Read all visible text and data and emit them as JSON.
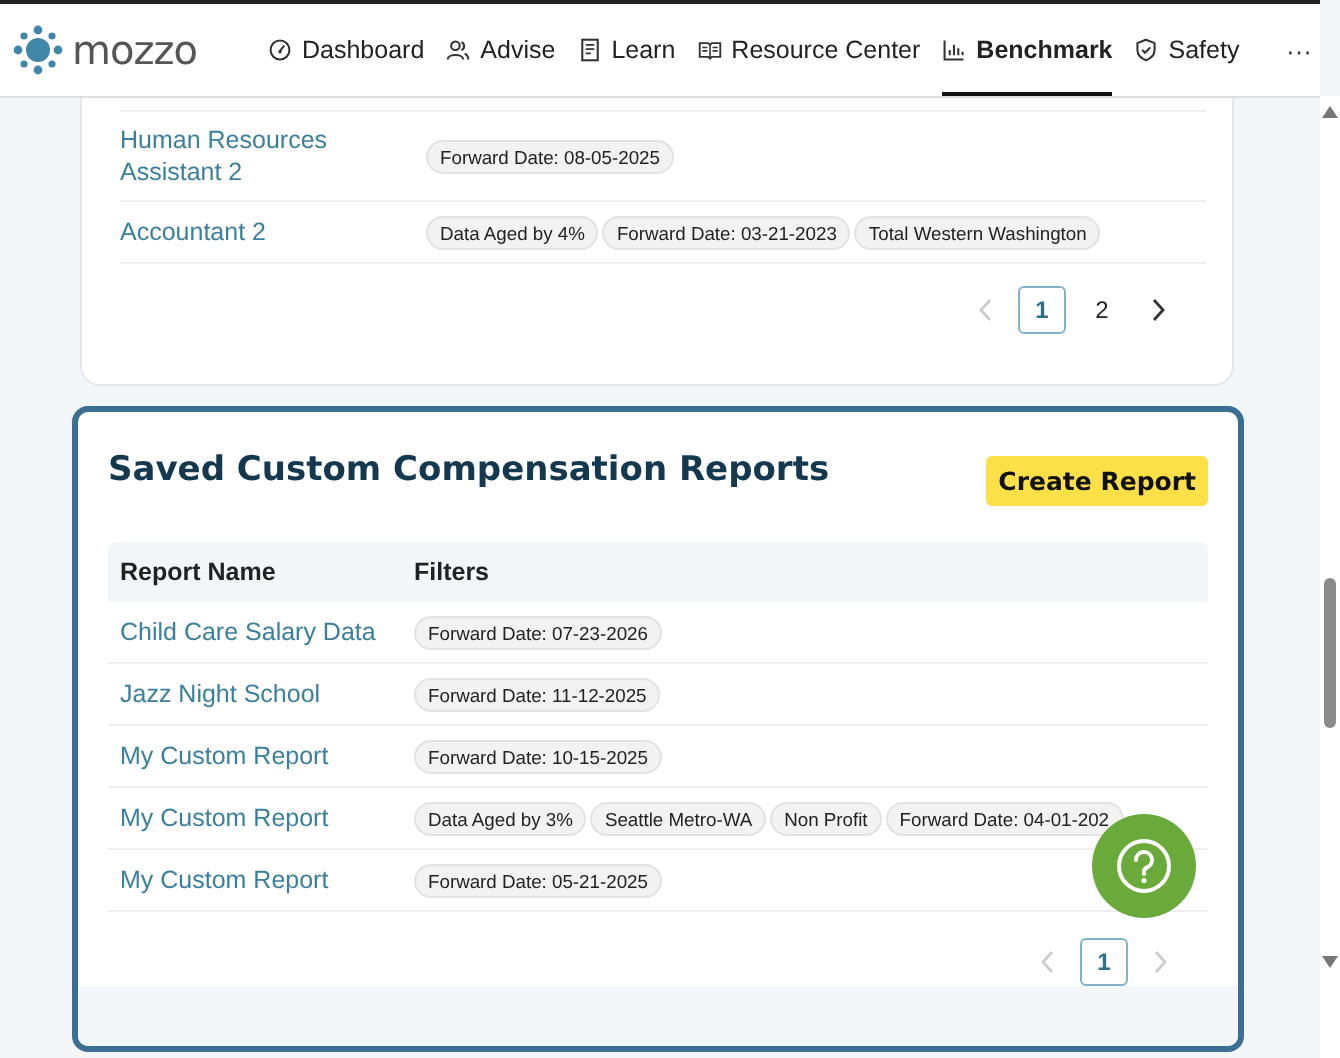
{
  "nav": {
    "logo": "mozzo",
    "items": [
      {
        "label": "Dashboard",
        "selected": false
      },
      {
        "label": "Advise",
        "selected": false
      },
      {
        "label": "Learn",
        "selected": false
      },
      {
        "label": "Resource Center",
        "selected": false
      },
      {
        "label": "Benchmark",
        "selected": true
      },
      {
        "label": "Safety",
        "selected": false
      }
    ],
    "more": "···"
  },
  "top_table": {
    "rows": [
      {
        "name": "Human Resources Assistant 2",
        "filters": [
          "Forward Date: 08-05-2025"
        ]
      },
      {
        "name": "Accountant 2",
        "filters": [
          "Data Aged by 4%",
          "Forward Date: 03-21-2023",
          "Total Western Washington"
        ]
      }
    ],
    "pagination": {
      "prev_disabled": true,
      "next_disabled": false,
      "pages": [
        {
          "label": "1",
          "selected": true
        },
        {
          "label": "2",
          "selected": false
        }
      ]
    }
  },
  "reports": {
    "title": "Saved Custom Compensation Reports",
    "create_button": "Create Report",
    "columns": [
      "Report Name",
      "Filters"
    ],
    "rows": [
      {
        "name": "Child Care Salary Data",
        "filters": [
          "Forward Date: 07-23-2026"
        ]
      },
      {
        "name": "Jazz Night School",
        "filters": [
          "Forward Date: 11-12-2025"
        ]
      },
      {
        "name": "My Custom Report",
        "filters": [
          "Forward Date: 10-15-2025"
        ]
      },
      {
        "name": "My Custom Report",
        "filters": [
          "Data Aged by 3%",
          "Seattle Metro-WA",
          "Non Profit",
          "Forward Date: 04-01-202"
        ]
      },
      {
        "name": "My Custom Report",
        "filters": [
          "Forward Date: 05-21-2025"
        ]
      }
    ],
    "pagination": {
      "prev_disabled": true,
      "next_disabled": true,
      "pages": [
        {
          "label": "1",
          "selected": true
        }
      ]
    }
  }
}
